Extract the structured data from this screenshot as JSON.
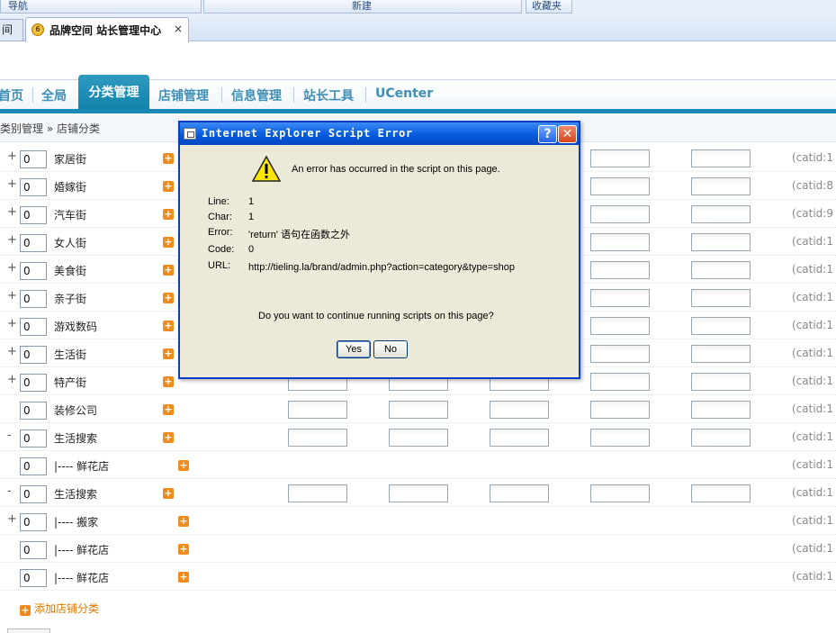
{
  "command_bar": {
    "nav_label": "导航",
    "new_label": "新建",
    "favorites_label": "收藏夹"
  },
  "tabs": {
    "prev_tab_label": "间",
    "active_tab_label": "品牌空间 站长管理中心",
    "close_glyph": "×",
    "favicon_glyph": "6"
  },
  "nav": {
    "items": [
      "首页",
      "全局",
      "分类管理",
      "店铺管理",
      "信息管理",
      "站长工具",
      "UCenter"
    ],
    "active": "分类管理"
  },
  "breadcrumb": "类别管理 » 店铺分类",
  "rows": [
    {
      "toggle": "+",
      "order": "0",
      "name": "家居街",
      "sub": false,
      "fields": true,
      "catid": "(catid:1"
    },
    {
      "toggle": "+",
      "order": "0",
      "name": "婚嫁街",
      "sub": false,
      "fields": true,
      "catid": "(catid:8"
    },
    {
      "toggle": "+",
      "order": "0",
      "name": "汽车街",
      "sub": false,
      "fields": true,
      "catid": "(catid:9"
    },
    {
      "toggle": "+",
      "order": "0",
      "name": "女人街",
      "sub": false,
      "fields": true,
      "catid": "(catid:1"
    },
    {
      "toggle": "+",
      "order": "0",
      "name": "美食街",
      "sub": false,
      "fields": true,
      "catid": "(catid:1"
    },
    {
      "toggle": "+",
      "order": "0",
      "name": "亲子街",
      "sub": false,
      "fields": true,
      "catid": "(catid:1"
    },
    {
      "toggle": "+",
      "order": "0",
      "name": "游戏数码",
      "sub": false,
      "fields": true,
      "catid": "(catid:1"
    },
    {
      "toggle": "+",
      "order": "0",
      "name": "生活街",
      "sub": false,
      "fields": true,
      "catid": "(catid:1"
    },
    {
      "toggle": "+",
      "order": "0",
      "name": "特产街",
      "sub": false,
      "fields": true,
      "catid": "(catid:1"
    },
    {
      "toggle": "",
      "order": "0",
      "name": "装修公司",
      "sub": false,
      "fields": true,
      "catid": "(catid:1"
    },
    {
      "toggle": "-",
      "order": "0",
      "name": "生活搜索",
      "sub": false,
      "fields": true,
      "catid": "(catid:1"
    },
    {
      "toggle": "",
      "order": "0",
      "name": "|---- 鲜花店",
      "sub": true,
      "fields": false,
      "catid": "(catid:1"
    },
    {
      "toggle": "-",
      "order": "0",
      "name": "生活搜索",
      "sub": false,
      "fields": true,
      "catid": "(catid:1"
    },
    {
      "toggle": "+",
      "order": "0",
      "name": "|---- 搬家",
      "sub": true,
      "fields": false,
      "catid": "(catid:1"
    },
    {
      "toggle": "",
      "order": "0",
      "name": "|---- 鲜花店",
      "sub": true,
      "fields": false,
      "catid": "(catid:1"
    },
    {
      "toggle": "",
      "order": "0",
      "name": "|---- 鲜花店",
      "sub": true,
      "fields": false,
      "catid": "(catid:1"
    }
  ],
  "add_link": "添加店铺分类",
  "dialog": {
    "title": "Internet Explorer Script Error",
    "help_glyph": "?",
    "close_glyph": "✕",
    "message": "An error has occurred in the script on this page.",
    "details": [
      {
        "label": "Line:",
        "value": "1"
      },
      {
        "label": "Char:",
        "value": "1"
      },
      {
        "label": "Error:",
        "value": "'return' 语句在函数之外"
      },
      {
        "label": "Code:",
        "value": "0"
      },
      {
        "label": "URL:",
        "value": "http://tieling.la/brand/admin.php?action=category&type=shop"
      }
    ],
    "question": "Do you want to continue running scripts on this page?",
    "yes_label": "Yes",
    "no_label": "No"
  }
}
